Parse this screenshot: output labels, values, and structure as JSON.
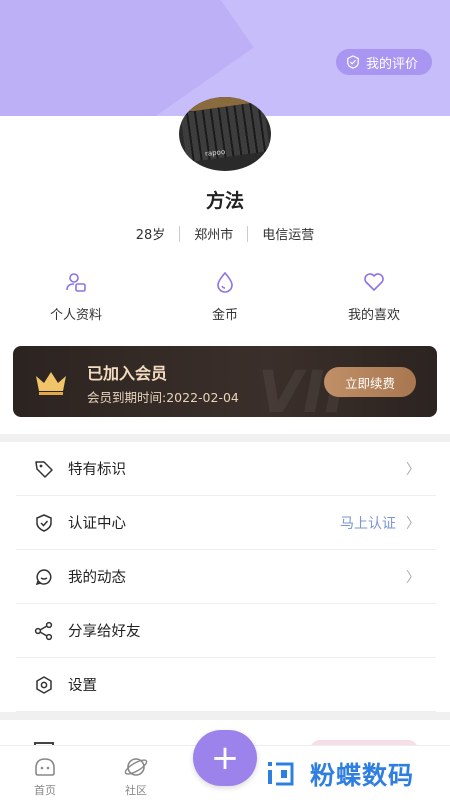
{
  "header": {
    "rating_label": "我的评价"
  },
  "profile": {
    "name": "方法",
    "avatar_brand": "rapoo",
    "tags": [
      "28岁",
      "郑州市",
      "电信运营"
    ]
  },
  "quick_actions": [
    {
      "label": "个人资料",
      "icon": "profile-card-icon"
    },
    {
      "label": "金币",
      "icon": "droplet-icon"
    },
    {
      "label": "我的喜欢",
      "icon": "heart-icon"
    }
  ],
  "vip": {
    "watermark": "VIP",
    "title": "已加入会员",
    "expiry": "会员到期时间:2022-02-04",
    "button": "立即续费"
  },
  "menu": [
    {
      "label": "特有标识",
      "icon": "tag-icon",
      "extra": ""
    },
    {
      "label": "认证中心",
      "icon": "shield-icon",
      "extra": "马上认证"
    },
    {
      "label": "我的动态",
      "icon": "chat-bubble-icon",
      "extra": ""
    },
    {
      "label": "分享给好友",
      "icon": "share-icon",
      "extra": ""
    },
    {
      "label": "设置",
      "icon": "settings-icon",
      "extra": ""
    }
  ],
  "tabbar": {
    "home": "首页",
    "community": "社区",
    "fab": "+"
  },
  "watermark_logo": {
    "text": "粉蝶数码"
  },
  "colors": {
    "header": "#c8bdfb",
    "accent": "#9c83ec",
    "vip_bg": "#2c2421",
    "vip_text": "#f3dcc0",
    "link": "#7b95d6",
    "logo": "#2f7fe0"
  }
}
